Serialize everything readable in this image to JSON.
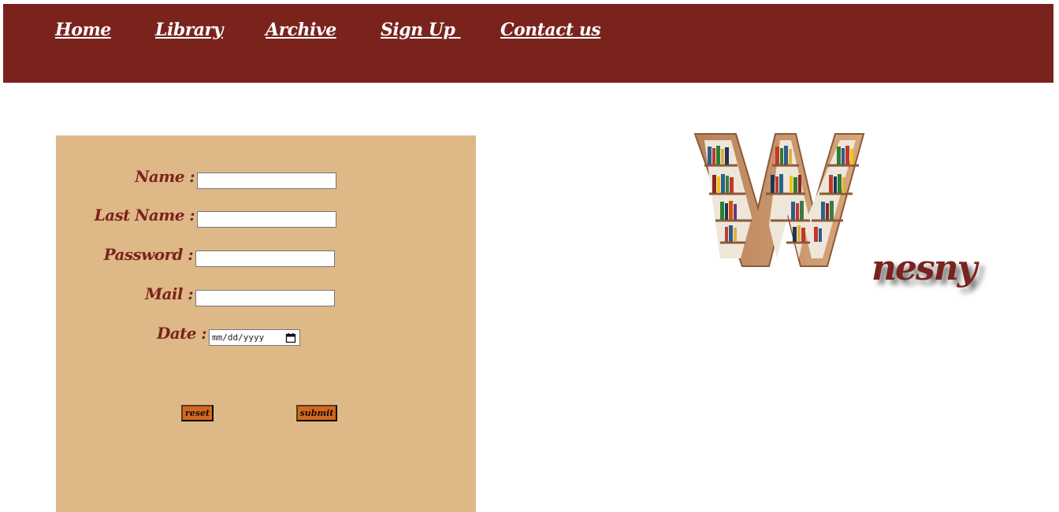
{
  "nav": {
    "items": [
      {
        "label": "Home"
      },
      {
        "label": "Library"
      },
      {
        "label": "Archive"
      },
      {
        "label": "Sign Up "
      },
      {
        "label": "Contact us"
      }
    ]
  },
  "form": {
    "fields": {
      "name": {
        "label": "Name :",
        "value": ""
      },
      "last_name": {
        "label": "Last Name :",
        "value": ""
      },
      "password": {
        "label": "Password :",
        "value": ""
      },
      "mail": {
        "label": "Mail :",
        "value": ""
      },
      "date": {
        "label": "Date :",
        "placeholder": "mm/dd/yyyy",
        "icon": "calendar-icon"
      }
    },
    "buttons": {
      "reset": "reset",
      "submit": "submit"
    }
  },
  "logo": {
    "text": "nesny",
    "icon": "bookshelf-w-icon"
  },
  "colors": {
    "nav_background": "#7a231d",
    "form_background": "#deb887",
    "label_color": "#7a231d",
    "button_color": "#d2691e"
  }
}
